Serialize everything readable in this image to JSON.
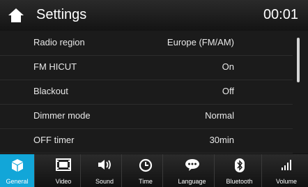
{
  "header": {
    "title": "Settings",
    "time": "00:01"
  },
  "rows": [
    {
      "label": "Radio region",
      "value": "Europe (FM/AM)"
    },
    {
      "label": "FM HICUT",
      "value": "On"
    },
    {
      "label": "Blackout",
      "value": "Off"
    },
    {
      "label": "Dimmer mode",
      "value": "Normal"
    },
    {
      "label": "OFF timer",
      "value": "30min"
    }
  ],
  "tabs": [
    {
      "label": "General",
      "icon": "general-cube-icon",
      "active": true
    },
    {
      "label": "Video",
      "icon": "film-icon",
      "active": false
    },
    {
      "label": "Sound",
      "icon": "speaker-icon",
      "active": false
    },
    {
      "label": "Time",
      "icon": "clock-icon",
      "active": false
    },
    {
      "label": "Language",
      "icon": "speech-bubble-icon",
      "active": false
    },
    {
      "label": "Bluetooth",
      "icon": "bluetooth-icon",
      "active": false
    },
    {
      "label": "Volume",
      "icon": "signal-bars-icon",
      "active": false
    }
  ],
  "colors": {
    "accent": "#12a6d8",
    "background": "#1b1b1b",
    "text": "#e8e8e8"
  }
}
